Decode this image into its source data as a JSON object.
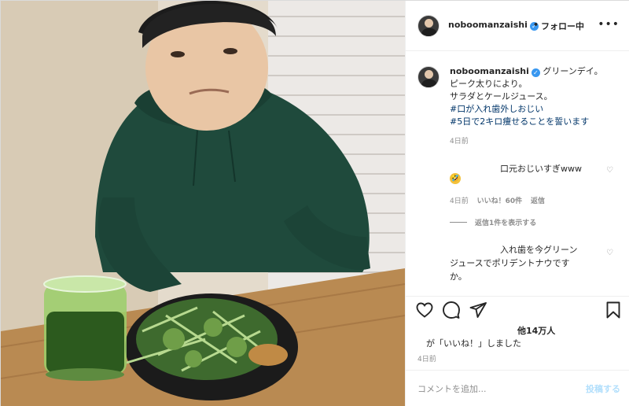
{
  "post": {
    "author": "noboomanzaishi",
    "follow_separator": "•",
    "follow_status": "フォロー中",
    "more_menu": "•••",
    "verified_mark": "✓"
  },
  "caption": {
    "username": "noboomanzaishi",
    "line1": "グリーンデイ。",
    "line2": "ピーク太りにより。",
    "line3": "サラダとケールジュース。",
    "hashtag1": "#口が入れ歯外しおじい",
    "hashtag2": "#5日で2キロ痩せることを誓います",
    "time": "4日前"
  },
  "comments": [
    {
      "text": "口元おじいすぎwww",
      "emoji": "🤣",
      "time": "4日前",
      "likes": "いいね！60件",
      "reply": "返信"
    },
    {
      "text_line1": "入れ歯を今グリーン",
      "text_line2": "ジュースでポリデントナウです",
      "text_line3": "か。"
    }
  ],
  "view_replies": "返信1件を表示する",
  "actions": {
    "like_icon": "heart-icon",
    "comment_icon": "comment-icon",
    "share_icon": "paper-plane-icon",
    "save_icon": "bookmark-icon"
  },
  "likes_summary": {
    "count": "他14万人",
    "sub": "が「いいね！」しました"
  },
  "post_time": "4日前",
  "add_comment": {
    "placeholder": "コメントを追加...",
    "post_label": "投稿する"
  }
}
